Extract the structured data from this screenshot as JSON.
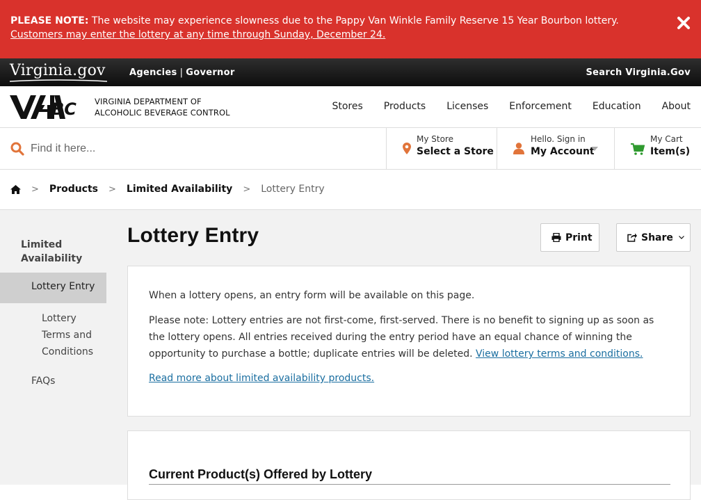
{
  "alert": {
    "lead": "PLEASE NOTE:",
    "message": " The website may experience slowness due to the Pappy Van Winkle Family Reserve 15 Year Bourbon lottery. ",
    "link": "Customers may enter the lottery at any time through Sunday, December 24."
  },
  "vabar": {
    "logo": "Virginia.gov",
    "agencies": "Agencies",
    "divider": "|",
    "governor": "Governor",
    "search": "Search Virginia.Gov"
  },
  "brand": {
    "logo_text": "VA ABC",
    "line1": "VIRGINIA DEPARTMENT OF",
    "line2": "ALCOHOLIC BEVERAGE CONTROL"
  },
  "nav": [
    "Stores",
    "Products",
    "Licenses",
    "Enforcement",
    "Education",
    "About"
  ],
  "search": {
    "placeholder": "Find it here..."
  },
  "store": {
    "small": "My Store",
    "big": "Select a Store"
  },
  "account": {
    "small": "Hello. Sign in",
    "big": "My Account"
  },
  "cart": {
    "small": "My Cart",
    "big": "Item(s)"
  },
  "breadcrumb": {
    "sep": ">",
    "items": [
      "Products",
      "Limited Availability"
    ],
    "current": "Lottery Entry"
  },
  "sidenav": {
    "heading": "Limited Availability",
    "active": "Lottery Entry",
    "sub": "Lottery Terms and Conditions",
    "faq": "FAQs"
  },
  "page": {
    "title": "Lottery Entry",
    "print": "Print",
    "share": "Share"
  },
  "content": {
    "p1": "When a lottery opens, an entry form will be available on this page.",
    "p2": "Please note: Lottery entries are not first-come, first-served. There is no benefit to signing up as soon as the lottery opens. All entries received during the entry period have an equal chance of winning the opportunity to purchase a bottle; duplicate entries will be deleted. ",
    "p2_link": "View lottery terms and conditions.",
    "p3_link": "Read more about limited availability products.",
    "section_title": "Current Product(s) Offered by Lottery"
  },
  "colors": {
    "alert": "#d9322c",
    "accent": "#e1743a",
    "cart": "#2f9a2f",
    "link": "#1a6ea0"
  },
  "icons": {
    "close": "close-icon",
    "search": "search-icon",
    "store": "map-marker-icon",
    "account": "user-icon",
    "cart": "cart-icon",
    "home": "home-icon",
    "print": "print-icon",
    "share": "share-icon"
  }
}
